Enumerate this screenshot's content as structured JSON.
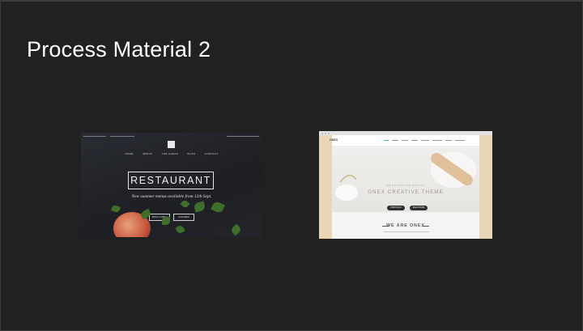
{
  "slide": {
    "title": "Process Material 2"
  },
  "thumbnails": [
    {
      "name": "restaurant-theme-preview",
      "nav": [
        "HOME",
        "ABOUT",
        "THE CHEFS",
        "BLOG",
        "CONTACT"
      ],
      "heading": "RESTAURANT",
      "subheading": "New summer menus available from 12th Sept.",
      "buttons": [
        "BOOK A TABLE",
        "OUR MENU"
      ]
    },
    {
      "name": "onex-theme-preview",
      "brand": "ONEX",
      "hero_kicker": "WE DELIVER THE QUALITY",
      "hero_title": "ONEX CREATIVE THEME",
      "buttons": [
        "PORTFOLIO",
        "READ MORE"
      ],
      "section_title": "WE ARE ONEX"
    }
  ],
  "colors": {
    "background": "#212121",
    "title": "#ffffff"
  }
}
